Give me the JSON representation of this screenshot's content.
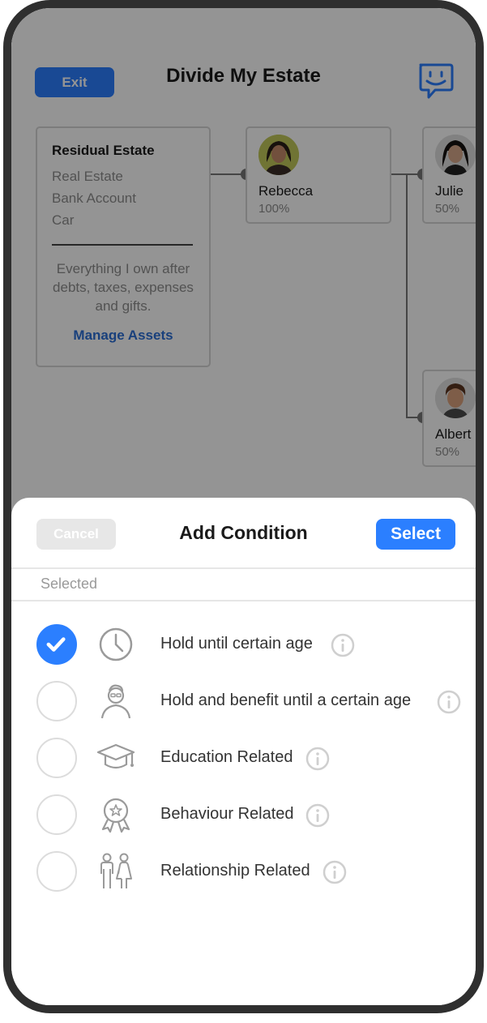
{
  "app": {
    "exit_label": "Exit",
    "title": "Divide My Estate",
    "residual_card": {
      "title": "Residual Estate",
      "assets": [
        "Real Estate",
        "Bank Account",
        "Car"
      ],
      "description": "Everything I own after debts, taxes, expenses and gifts.",
      "manage_label": "Manage Assets"
    },
    "beneficiaries": [
      {
        "name": "Rebecca",
        "share": "100%"
      },
      {
        "name": "Julie",
        "share": "50%"
      },
      {
        "name": "Albert",
        "share": "50%"
      }
    ]
  },
  "sheet": {
    "cancel_label": "Cancel",
    "title": "Add Condition",
    "select_label": "Select",
    "section_label": "Selected",
    "options": [
      {
        "label": "Hold until certain age",
        "icon": "clock-icon",
        "checked": true
      },
      {
        "label": "Hold and benefit until a certain age",
        "icon": "elder-person-icon",
        "checked": false
      },
      {
        "label": "Education Related",
        "icon": "graduation-cap-icon",
        "checked": false
      },
      {
        "label": "Behaviour Related",
        "icon": "award-ribbon-icon",
        "checked": false
      },
      {
        "label": "Relationship Related",
        "icon": "couple-icon",
        "checked": false
      }
    ]
  },
  "colors": {
    "accent": "#2b7fff",
    "link": "#2b6fd6",
    "phone_frame": "#2f2f2f"
  }
}
